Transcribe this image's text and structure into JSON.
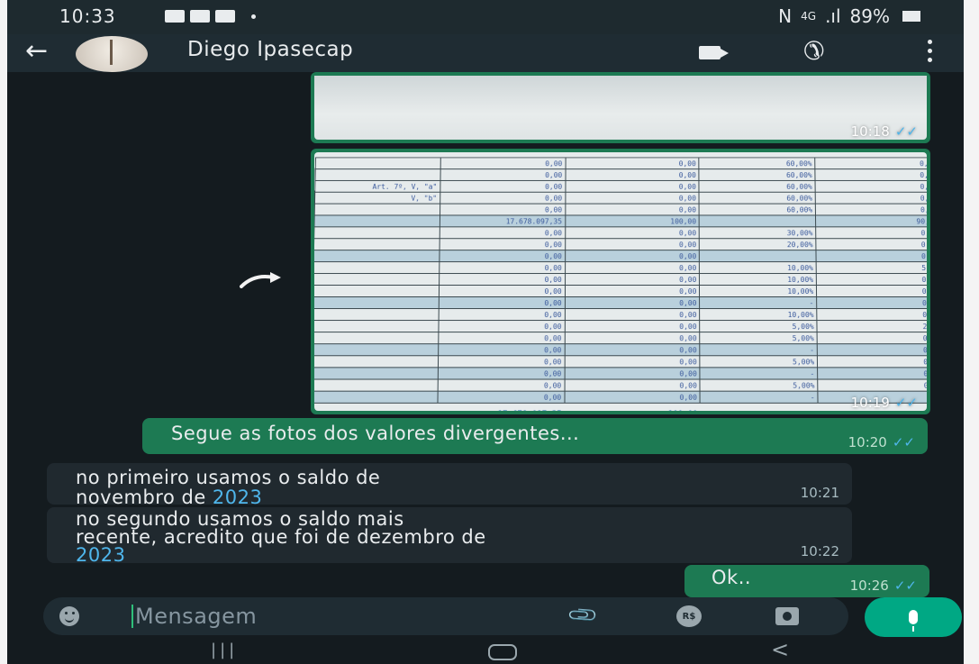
{
  "status_bar": {
    "time": "10:33",
    "signal_text": "N",
    "network": "4G",
    "bars": ".ıl",
    "battery": "89%"
  },
  "header": {
    "contact_name": "Diego Ipasecap",
    "back_icon": "arrow-left-icon",
    "video_icon": "video-call-icon",
    "phone_icon": "phone-icon",
    "menu_icon": "more-vert-icon"
  },
  "messages": [
    {
      "type": "image",
      "direction": "out",
      "time": "10:18",
      "status": "read"
    },
    {
      "type": "image",
      "direction": "out",
      "time": "10:19",
      "status": "read"
    },
    {
      "type": "text",
      "direction": "out",
      "text": "Segue as fotos dos valores divergentes...",
      "time": "10:20",
      "status": "read"
    },
    {
      "type": "text",
      "direction": "in",
      "text_before": "no primeiro usamos o saldo de\nnovembro de ",
      "link": "2023",
      "time": "10:21"
    },
    {
      "type": "text",
      "direction": "in",
      "text_before": "no segundo usamos o saldo mais\nrecente, acredito que foi de dezembro de\n",
      "link": "2023",
      "time": "10:22"
    },
    {
      "type": "text",
      "direction": "out",
      "text": "Ok..",
      "time": "10:26",
      "status": "read"
    }
  ],
  "sheet_photo": {
    "rows": [
      [
        "",
        "0,00",
        "0,00",
        "60,00%",
        "0,00"
      ],
      [
        "",
        "0,00",
        "0,00",
        "60,00%",
        "0,00"
      ],
      [
        "Art. 7º, V, \"a\"",
        "0,00",
        "0,00",
        "60,00%",
        "0,00"
      ],
      [
        "V, \"b\"",
        "0,00",
        "0,00",
        "60,00%",
        "0,00"
      ],
      [
        "",
        "0,00",
        "0,00",
        "60,00%",
        "0,00"
      ],
      [
        "",
        "17.678.097,35",
        "100,00",
        "",
        "90,00"
      ],
      [
        "",
        "0,00",
        "0,00",
        "30,00%",
        "0,00"
      ],
      [
        "",
        "0,00",
        "0,00",
        "20,00%",
        "0,00"
      ],
      [
        "",
        "0,00",
        "0,00",
        "",
        "0,00"
      ],
      [
        "",
        "0,00",
        "0,00",
        "10,00%",
        "5,00"
      ],
      [
        "",
        "0,00",
        "0,00",
        "10,00%",
        "0,00"
      ],
      [
        "",
        "0,00",
        "0,00",
        "10,00%",
        "0,00"
      ],
      [
        "",
        "0,00",
        "0,00",
        "-",
        "0,00"
      ],
      [
        "",
        "0,00",
        "0,00",
        "10,00%",
        "0,00"
      ],
      [
        "",
        "0,00",
        "0,00",
        "5,00%",
        "2,00"
      ],
      [
        "",
        "0,00",
        "0,00",
        "5,00%",
        "0,00"
      ],
      [
        "",
        "0,00",
        "0,00",
        "-",
        "0,00"
      ],
      [
        "",
        "0,00",
        "0,00",
        "5,00%",
        "0,00"
      ],
      [
        "",
        "0,00",
        "0,00",
        "-",
        "0,00"
      ],
      [
        "",
        "0,00",
        "0,00",
        "5,00%",
        "0,00"
      ],
      [
        "",
        "0,00",
        "0,00",
        "-",
        ""
      ]
    ],
    "highlight_rows": [
      5,
      8,
      12,
      16,
      18,
      20
    ],
    "total_value": "17.678.097,35",
    "total_percent": "100,00"
  },
  "input": {
    "placeholder": "Mensagem",
    "currency_label": "R$"
  },
  "colors": {
    "outgoing_bubble": "#1d7a53",
    "incoming_bubble": "#20292f",
    "background": "#141b1f",
    "link": "#4fb6ec",
    "accent": "#00a884"
  }
}
